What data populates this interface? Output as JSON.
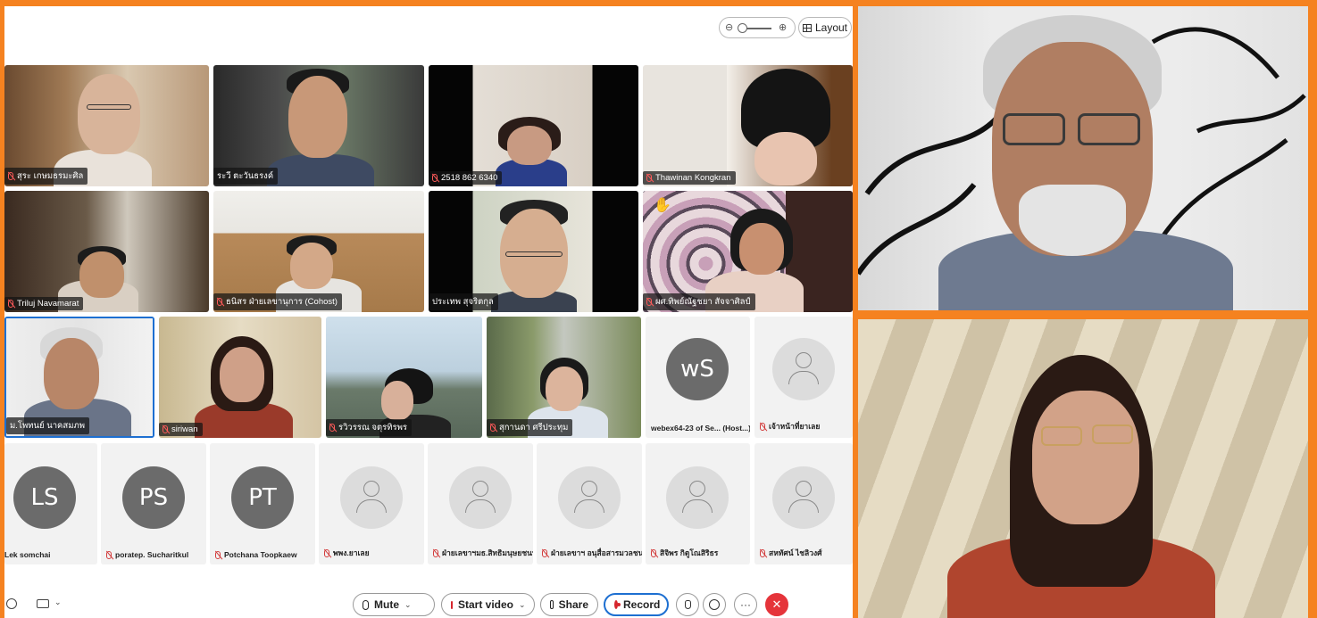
{
  "zoom": {
    "out_glyph": "⊖",
    "in_glyph": "⊕"
  },
  "layout_button": {
    "label": "Layout"
  },
  "video_tiles": [
    {
      "name": "สุระ เกษมธรมะศิล"
    },
    {
      "name": "ระวี ตะวันธรงค์"
    },
    {
      "name": "2518 862 6340"
    },
    {
      "name": "Thawinan Kongkran"
    },
    {
      "name": "Triluj Navamarat"
    },
    {
      "name": "ธนิสร ฝ่ายเลขานุการ (Cohost)"
    },
    {
      "name": "ประเทพ สุจริตกุล"
    },
    {
      "name": "ผศ.ทิพย์ณัฐชยา สัจจาศิลป์"
    },
    {
      "name": "ม.โพทนย์ นาคสมภพ"
    },
    {
      "name": "siriwan"
    },
    {
      "name": "รวิวรรณ จตุรทิรพร"
    },
    {
      "name": "สุกานดา ศรีประทุม"
    }
  ],
  "avatar_tiles": [
    {
      "initials": "wS",
      "name": "webex64-23 of Se... (Host...)"
    },
    {
      "initials": "",
      "name": "เจ้าหน้าที่ยาเลย"
    },
    {
      "initials": "LS",
      "name": "Lek somchai"
    },
    {
      "initials": "PS",
      "name": "poratep. Sucharitkul"
    },
    {
      "initials": "PT",
      "name": "Potchana Toopkaew"
    },
    {
      "initials": "",
      "name": "พพง.ยาเลย"
    },
    {
      "initials": "",
      "name": "ฝ่ายเลขาฯมธ.สิทธิมนุษยชนฯ..."
    },
    {
      "initials": "",
      "name": "ฝ่ายเลขาฯ อนุสื่อสารมวลชน"
    },
    {
      "initials": "",
      "name": "สิจิพร กิตูโณสิริธร"
    },
    {
      "initials": "",
      "name": "สหทัศน์ ไชลิวงศ์"
    }
  ],
  "toolbar": {
    "mute_label": "Mute",
    "start_video_label": "Start video",
    "share_label": "Share",
    "record_label": "Record",
    "more_label": "···",
    "end_label": "✕",
    "chev": "⌄"
  },
  "colors": {
    "frame": "#f58220",
    "end_call": "#e5343a",
    "record": "#d6262e",
    "muted": "#ff5a5a"
  }
}
